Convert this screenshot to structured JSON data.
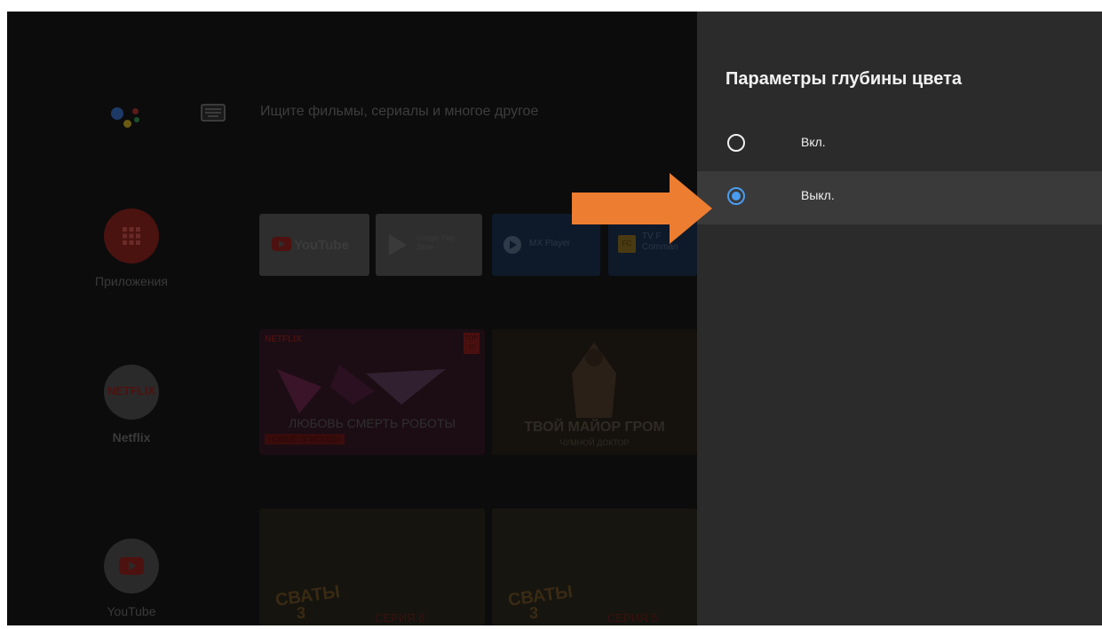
{
  "home": {
    "search_placeholder": "Ищите фильмы, сериалы и многое другое",
    "sidebar": [
      {
        "label": "Приложения",
        "icon": "apps-grid-icon"
      },
      {
        "label": "Netflix",
        "icon": "netflix-logo",
        "logo_text": "NETFLIX"
      },
      {
        "label": "YouTube",
        "icon": "youtube-logo"
      }
    ],
    "favorites": [
      {
        "name": "YouTube",
        "icon": "youtube-logo"
      },
      {
        "name": "Google Play Store",
        "line1": "Google Play",
        "line2": "Store",
        "icon": "play-store-icon"
      },
      {
        "name": "MX Player",
        "icon": "mx-player-icon"
      },
      {
        "name": "TV File Commander",
        "line1": "TV F",
        "line2": "Comman",
        "badge": "FC",
        "icon": "file-commander-icon"
      }
    ],
    "netflix_row": [
      {
        "brand": "NETFLIX",
        "title": "ЛЮБОВЬ СМЕРТЬ РОБОТЫ",
        "badge": "НОВЫЕ ЭПИЗОДЫ",
        "top_badge_line1": "TOP",
        "top_badge_line2": "10"
      },
      {
        "title": "ТВОЙ МАЙОР ГРОМ",
        "subtitle": "ЧУМНОЙ ДОКТОР"
      }
    ],
    "youtube_row": [
      {
        "title": "СВАТЫ",
        "episode": "СЕРИЯ 6",
        "season": "3"
      },
      {
        "title": "СВАТЫ",
        "episode": "СЕРИЯ 5",
        "season": "3"
      }
    ]
  },
  "panel": {
    "title": "Параметры глубины цвета",
    "options": [
      {
        "label": "Вкл.",
        "selected": false
      },
      {
        "label": "Выкл.",
        "selected": true
      }
    ]
  },
  "colors": {
    "panel_bg": "#2b2b2b",
    "selected_row": "#3a3a3a",
    "radio_accent": "#4a9cf0",
    "arrow": "#ed7d31"
  }
}
